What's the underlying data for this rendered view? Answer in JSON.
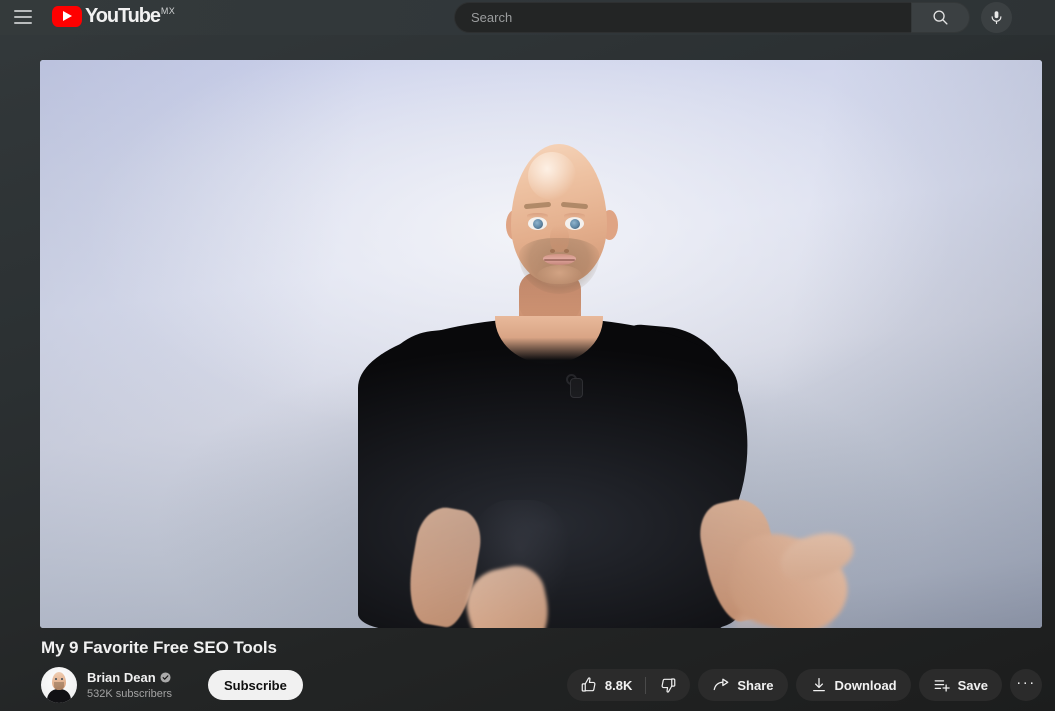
{
  "header": {
    "menu_icon": "hamburger-menu-icon",
    "logo": {
      "word": "YouTube",
      "country_code": "MX",
      "icon": "youtube-play-logo"
    },
    "search": {
      "placeholder": "Search",
      "value": "",
      "button_icon": "search-icon"
    },
    "voice_search_icon": "microphone-icon"
  },
  "player": {
    "scene": "bald man in black t-shirt gesturing with both hands against a light lavender-gray studio backdrop",
    "bg_top": "#d2d7ec",
    "bg_bottom": "#8f96a6",
    "shirt_color": "#09090b"
  },
  "video": {
    "title": "My 9 Favorite Free SEO Tools"
  },
  "owner": {
    "avatar_name": "channel-avatar",
    "name": "Brian Dean",
    "verified": true,
    "verified_icon": "verified-badge-icon",
    "subscribers": "532K subscribers",
    "subscribe_label": "Subscribe"
  },
  "actions": {
    "like": {
      "label": "8.8K",
      "icon": "thumbs-up-icon"
    },
    "dislike": {
      "label": "",
      "icon": "thumbs-down-icon"
    },
    "share": {
      "label": "Share",
      "icon": "share-arrow-icon"
    },
    "download": {
      "label": "Download",
      "icon": "download-icon"
    },
    "save": {
      "label": "Save",
      "icon": "playlist-add-icon"
    },
    "more": {
      "label": "···",
      "icon": "more-horizontal-icon"
    }
  }
}
